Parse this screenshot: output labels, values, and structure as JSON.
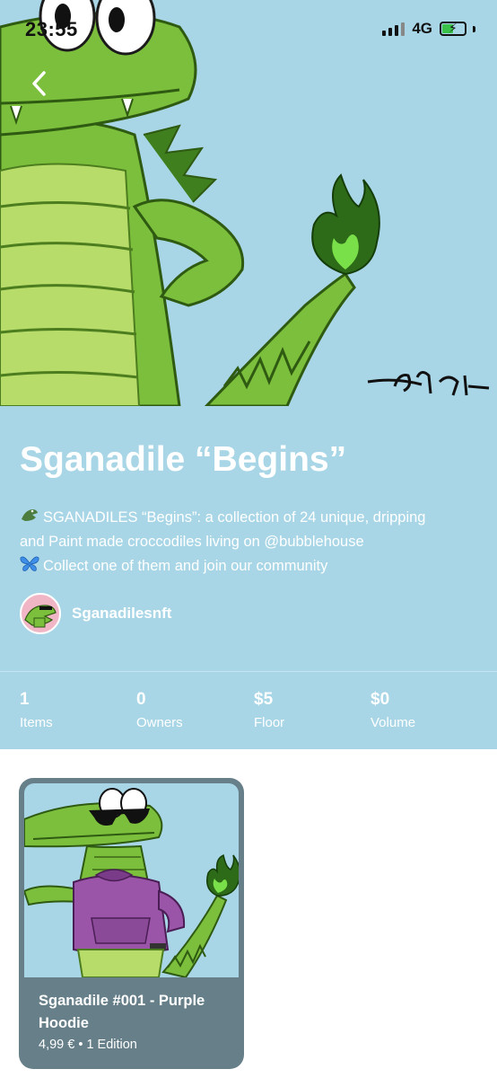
{
  "status_bar": {
    "time": "23:55",
    "network": "4G"
  },
  "hero": {
    "signature": "Sgana.k"
  },
  "collection": {
    "title": "Sganadile “Begins”",
    "description_lines": [
      "SGANADILES “Begins”: a collection of 24 unique, dripping",
      "and Paint made croccodiles living on @bubblehouse",
      "Collect one of them and join our community"
    ],
    "creator": "Sganadilesnft"
  },
  "stats": [
    {
      "value": "1",
      "label": "Items"
    },
    {
      "value": "0",
      "label": "Owners"
    },
    {
      "value": "$5",
      "label": "Floor"
    },
    {
      "value": "$0",
      "label": "Volume"
    }
  ],
  "items": [
    {
      "title": "Sganadile #001 - Purple Hoodie",
      "price": "4,99 € • 1 Edition",
      "badge": "#001"
    }
  ],
  "icons": {
    "back": "chevron-left-icon",
    "crocodile": "crocodile-emoji-icon",
    "butterfly": "butterfly-emoji-icon"
  },
  "colors": {
    "background_blue": "#a8d6e6",
    "card": "#667f89",
    "croc_green": "#7cbf3c",
    "hoodie_purple": "#9b55a8"
  }
}
